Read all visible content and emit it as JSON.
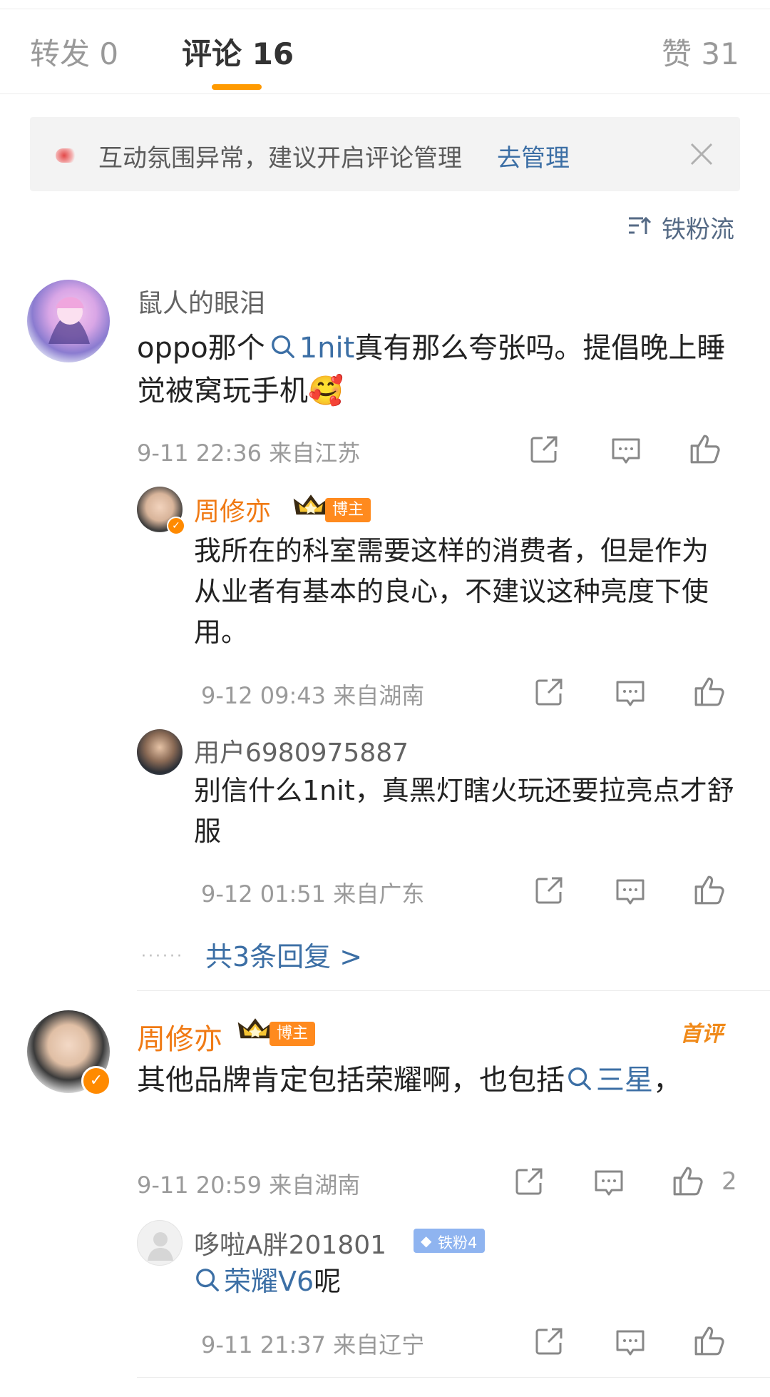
{
  "tabs": {
    "repost": "转发 0",
    "comment": "评论 16",
    "like": "赞 31"
  },
  "notice": {
    "text": "互动氛围异常，建议开启评论管理",
    "link": "去管理"
  },
  "sort_label": "铁粉流",
  "comments": [
    {
      "author": "鼠人的眼泪",
      "text_before": "oppo那个",
      "topic": "1nit",
      "text_after": "真有那么夸张吗。提倡晚上睡觉被窝玩手机",
      "emoji": "🥰",
      "meta": "9-11 22:36 来自江苏",
      "replies": [
        {
          "author": "周修亦",
          "badge": "博主",
          "text": "我所在的科室需要这样的消费者，但是作为从业者有基本的良心，不建议这种亮度下使用。",
          "meta": "9-12 09:43 来自湖南"
        },
        {
          "author": "用户6980975887",
          "text": "别信什么1nit，真黑灯瞎火玩还要拉亮点才舒服",
          "meta": "9-12 01:51 来自广东"
        }
      ],
      "more_replies": "共3条回复 >"
    },
    {
      "author": "周修亦",
      "badge": "博主",
      "tag": "首评",
      "text_before": "其他品牌肯定包括荣耀啊，也包括",
      "topic": "三星",
      "text_after": "，",
      "meta": "9-11 20:59 来自湖南",
      "like_count": "2",
      "replies": [
        {
          "author": "哆啦A胖201801",
          "fan_badge": "铁粉4",
          "topic": "荣耀V6",
          "text_after": "呢",
          "meta": "9-11 21:37 来自辽宁"
        }
      ]
    }
  ],
  "colors": {
    "accent_orange": "#ff9a00",
    "name_orange": "#f07a14",
    "link_blue": "#3c6fa5",
    "fan_badge_blue": "#8fb4f0"
  }
}
